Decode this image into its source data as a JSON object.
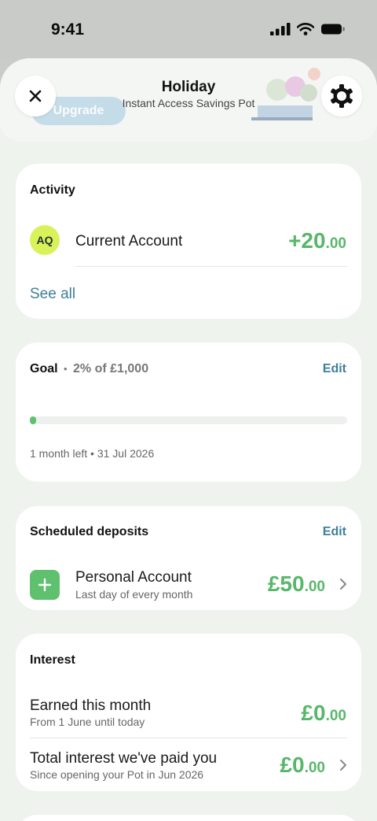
{
  "status_bar": {
    "time": "9:41"
  },
  "header": {
    "title": "Holiday",
    "subtitle": "Instant Access Savings Pot",
    "background_button": "Upgrade"
  },
  "activity": {
    "title": "Activity",
    "item": {
      "initials": "AQ",
      "label": "Current Account",
      "amount_major": "+20",
      "amount_minor": ".00"
    },
    "see_all": "See all"
  },
  "goal": {
    "title": "Goal",
    "separator": "•",
    "progress_text": "2% of £1,000",
    "edit": "Edit",
    "progress_fraction": 0.02,
    "time_left": "1 month left • 31 Jul 2026"
  },
  "scheduled": {
    "title": "Scheduled deposits",
    "edit": "Edit",
    "item": {
      "label": "Personal Account",
      "sub": "Last day of every month",
      "amount_major": "£50",
      "amount_minor": ".00"
    }
  },
  "interest": {
    "title": "Interest",
    "earned": {
      "label": "Earned this month",
      "sub": "From 1 June until today",
      "amount_major": "£0",
      "amount_minor": ".00"
    },
    "total": {
      "label": "Total interest we've paid you",
      "sub": "Since opening your Pot in Jun 2026",
      "amount_major": "£0",
      "amount_minor": ".00"
    }
  },
  "colors": {
    "accent_green": "#58b76a",
    "link_blue": "#3e7f9c",
    "avatar_yellow": "#d9f25a"
  }
}
